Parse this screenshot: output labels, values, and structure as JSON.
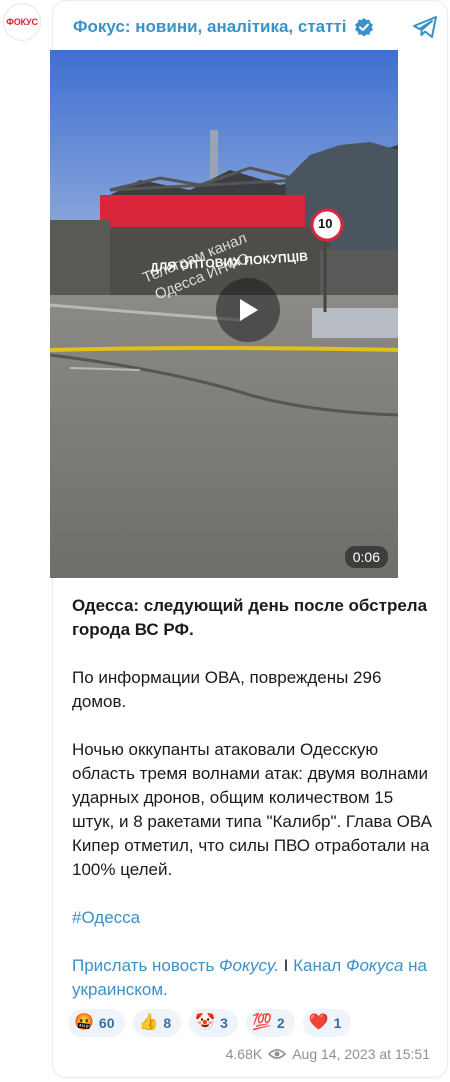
{
  "avatar": {
    "label": "ФОКУС"
  },
  "channel": {
    "title": "Фокус: новини, аналітика, статті"
  },
  "video": {
    "duration": "0:06",
    "watermark_line1": "Телеграм канал",
    "watermark_line2": "Одесса ИНФО",
    "sign_text": "ДЛЯ ОПТОВИХ ПОКУПЦІВ",
    "speed_sign": "10"
  },
  "post": {
    "headline": "Одесса: следующий день после обстрела города ВС РФ.",
    "paragraph1": "По информации ОВА, повреждены 296 домов.",
    "paragraph2": "Ночью оккупанты атаковали Одесскую область тремя волнами атак: двумя волнами ударных дронов, общим количеством 15 штук, и 8 ракетами типа \"Калибр\". Глава ОВА Кипер отметил, что силы ПВО отработали на 100% целей.",
    "hashtag": "#Одесса",
    "link1_prefix": "Прислать новость ",
    "link1_italic": "Фокусу.",
    "separator": " I ",
    "link2_prefix": "Канал ",
    "link2_italic": "Фокуса",
    "link2_suffix": " на украинском."
  },
  "reactions": [
    {
      "emoji": "🤬",
      "count": "60"
    },
    {
      "emoji": "👍",
      "count": "8"
    },
    {
      "emoji": "🤡",
      "count": "3"
    },
    {
      "emoji": "💯",
      "count": "2"
    },
    {
      "emoji": "❤️",
      "count": "1"
    }
  ],
  "meta": {
    "views": "4.68K",
    "date": "Aug 14, 2023 at 15:51"
  },
  "colors": {
    "accent": "#3a92c9",
    "brand_red": "#e0202c",
    "reaction_bg": "#eef4fa"
  }
}
